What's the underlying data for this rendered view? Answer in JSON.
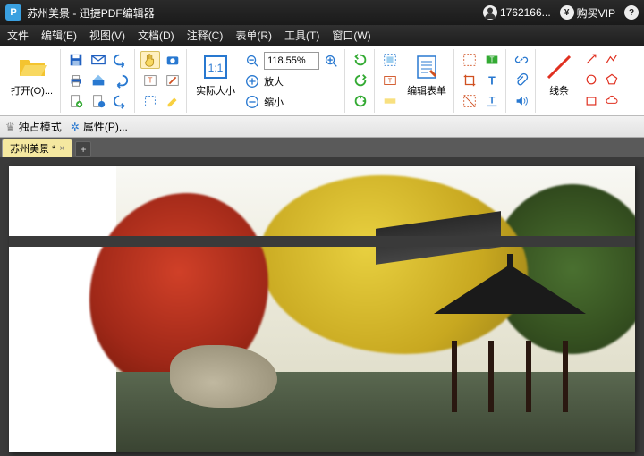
{
  "titlebar": {
    "app_icon_letter": "P",
    "doc_title": "苏州美景",
    "app_name": "迅捷PDF编辑器",
    "separator": " - ",
    "user_id": "1762166...",
    "vip_label": "购买VIP",
    "currency_symbol": "¥",
    "help_symbol": "?"
  },
  "menubar": {
    "file": "文件",
    "edit": "编辑(E)",
    "view": "视图(V)",
    "document": "文档(D)",
    "annotate": "注释(C)",
    "form": "表单(R)",
    "tools": "工具(T)",
    "window": "窗口(W)"
  },
  "toolbar": {
    "open_label": "打开(O)...",
    "actual_size_label": "实际大小",
    "zoom_value": "118.55%",
    "zoom_in_label": "放大",
    "zoom_out_label": "缩小",
    "edit_form_label": "编辑表单",
    "lines_label": "线条"
  },
  "propbar": {
    "exclusive_mode": "独占模式",
    "properties": "属性(P)..."
  },
  "tab": {
    "name": "苏州美景 *"
  }
}
